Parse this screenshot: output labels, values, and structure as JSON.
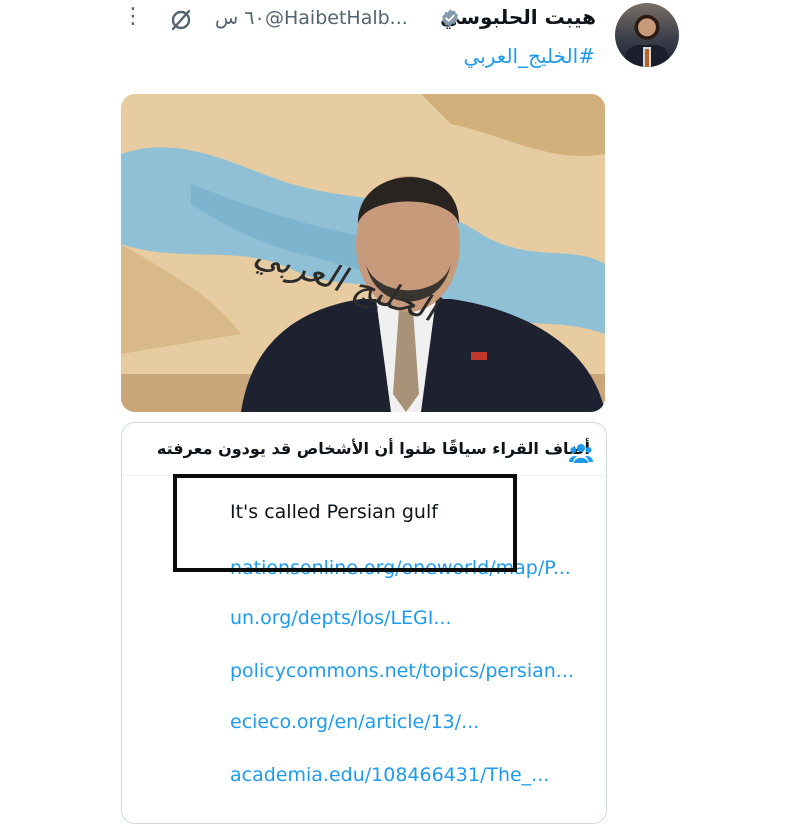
{
  "tweet": {
    "display_name": "هيبت الحلبوسي",
    "handle": "@HaibetHalb...",
    "time": "٦٠ س",
    "hashtag": "#الخليج_العربي"
  },
  "media": {
    "overlay_text": "الخليج العربي"
  },
  "community_note": {
    "header": "أضاف القراء سياقًا ظنوا أن الأشخاص قد يودون معرفته",
    "text": "It's called Persian gulf",
    "links": [
      "nationsonline.org/oneworld/map/P...",
      "un.org/depts/los/LEGI...",
      "policycommons.net/topics/persian...",
      "ecieco.org/en/article/13/...",
      "academia.edu/108466431/The_..."
    ]
  },
  "icons": {
    "verified": "verified-badge-icon",
    "grok": "grok-icon",
    "more": "more-options-icon",
    "people": "people-icon"
  },
  "colors": {
    "link": "#1d9bf0",
    "secondary_text": "#536471",
    "annotation_box": "#0b0b0b"
  }
}
